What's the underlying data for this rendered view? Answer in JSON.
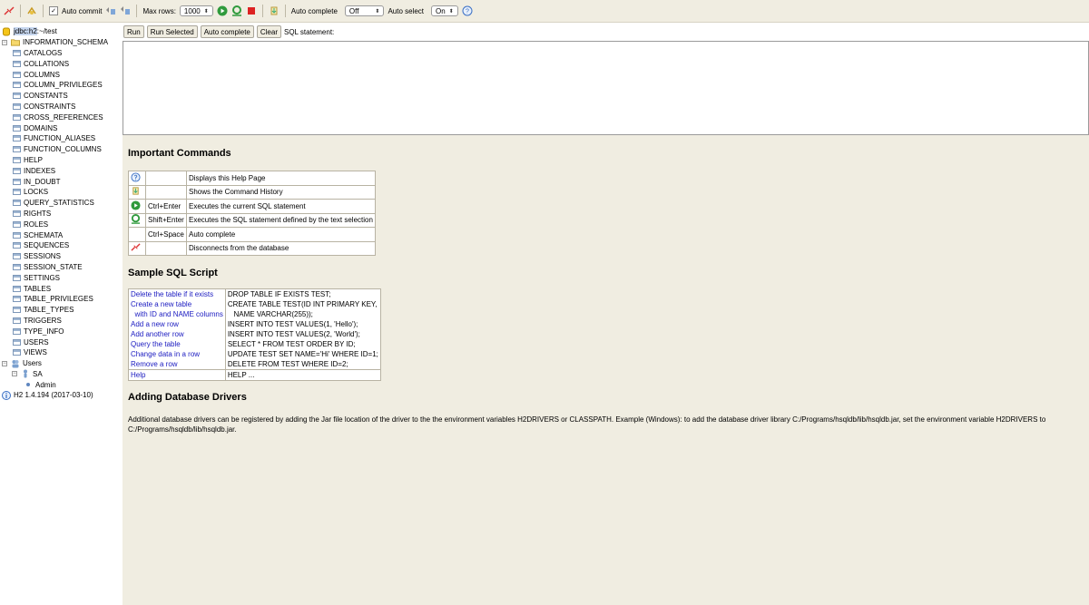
{
  "toolbar": {
    "auto_commit_label": "Auto commit",
    "max_rows_label": "Max rows:",
    "max_rows_value": "1000",
    "auto_complete_label": "Auto complete",
    "auto_complete_value": "Off",
    "auto_select_label": "Auto select",
    "auto_select_value": "On",
    "help_glyph": "?"
  },
  "sidebar": {
    "connection_prefix": "jdbc:h2",
    "connection_suffix": ":~/test",
    "schema": "INFORMATION_SCHEMA",
    "tables": [
      "CATALOGS",
      "COLLATIONS",
      "COLUMNS",
      "COLUMN_PRIVILEGES",
      "CONSTANTS",
      "CONSTRAINTS",
      "CROSS_REFERENCES",
      "DOMAINS",
      "FUNCTION_ALIASES",
      "FUNCTION_COLUMNS",
      "HELP",
      "INDEXES",
      "IN_DOUBT",
      "LOCKS",
      "QUERY_STATISTICS",
      "RIGHTS",
      "ROLES",
      "SCHEMATA",
      "SEQUENCES",
      "SESSIONS",
      "SESSION_STATE",
      "SETTINGS",
      "TABLES",
      "TABLE_PRIVILEGES",
      "TABLE_TYPES",
      "TRIGGERS",
      "TYPE_INFO",
      "USERS",
      "VIEWS"
    ],
    "users_label": "Users",
    "user_name": "SA",
    "user_role": "Admin",
    "version": "H2 1.4.194 (2017-03-10)"
  },
  "sqlbar": {
    "run": "Run",
    "run_selected": "Run Selected",
    "auto_complete": "Auto complete",
    "clear": "Clear",
    "label": "SQL statement:"
  },
  "help": {
    "important_title": "Important Commands",
    "commands": [
      {
        "icon": "help-icon",
        "key": "",
        "desc": "Displays this Help Page"
      },
      {
        "icon": "history-icon",
        "key": "",
        "desc": "Shows the Command History"
      },
      {
        "icon": "run-icon",
        "key": "Ctrl+Enter",
        "desc": "Executes the current SQL statement"
      },
      {
        "icon": "run-selected-icon",
        "key": "Shift+Enter",
        "desc": "Executes the SQL statement defined by the text selection"
      },
      {
        "icon": "",
        "key": "Ctrl+Space",
        "desc": "Auto complete"
      },
      {
        "icon": "disconnect-icon",
        "key": "",
        "desc": "Disconnects from the database"
      }
    ],
    "sample_title": "Sample SQL Script",
    "sample": [
      {
        "label": "Delete the table if it exists",
        "sql": "DROP TABLE IF EXISTS TEST;"
      },
      {
        "label": "Create a new table",
        "sql": "CREATE TABLE TEST(ID INT PRIMARY KEY,"
      },
      {
        "label": "  with ID and NAME columns",
        "sql": "   NAME VARCHAR(255));"
      },
      {
        "label": "Add a new row",
        "sql": "INSERT INTO TEST VALUES(1, 'Hello');"
      },
      {
        "label": "Add another row",
        "sql": "INSERT INTO TEST VALUES(2, 'World');"
      },
      {
        "label": "Query the table",
        "sql": "SELECT * FROM TEST ORDER BY ID;"
      },
      {
        "label": "Change data in a row",
        "sql": "UPDATE TEST SET NAME='Hi' WHERE ID=1;"
      },
      {
        "label": "Remove a row",
        "sql": "DELETE FROM TEST WHERE ID=2;"
      },
      {
        "label": "Help",
        "sql": "HELP ..."
      }
    ],
    "drivers_title": "Adding Database Drivers",
    "drivers_text": "Additional database drivers can be registered by adding the Jar file location of the driver to the the environment variables H2DRIVERS or CLASSPATH. Example (Windows): to add the database driver library C:/Programs/hsqldb/lib/hsqldb.jar, set the environment variable H2DRIVERS to C:/Programs/hsqldb/lib/hsqldb.jar."
  }
}
